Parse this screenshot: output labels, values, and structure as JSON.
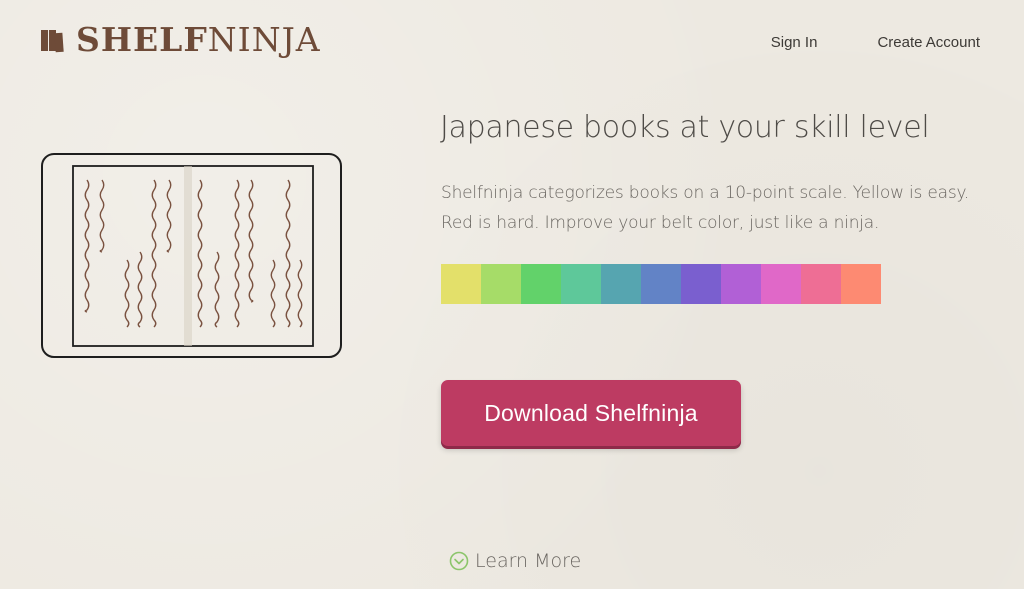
{
  "header": {
    "logo": {
      "bold_part": "SHELF",
      "light_part": "NINJA",
      "icon": "books-icon"
    },
    "nav": {
      "sign_in": "Sign In",
      "create_account": "Create Account"
    }
  },
  "hero": {
    "headline": "Japanese books at your skill level",
    "description_line1": "Shelfninja categorizes books on a 10-point scale. Yellow is easy.",
    "description_line2": "Red is hard. Improve your belt color, just like a ninja.",
    "scale_colors": [
      "#e3e06a",
      "#a6dc68",
      "#62d26a",
      "#5ec89a",
      "#56a5b0",
      "#6283c6",
      "#7a5fcf",
      "#b160d6",
      "#e068c8",
      "#ee6e95",
      "#fd8a72"
    ],
    "download_label": "Download Shelfninja",
    "learn_more_label": "Learn More",
    "learn_more_icon": "chevron-down-circle-icon",
    "illustration_icon": "open-book-illustration"
  },
  "colors": {
    "background": "#ede9e1",
    "brand": "#6e4b38",
    "button": "#bd3b62",
    "learn_more_icon": "#8cc56b"
  }
}
